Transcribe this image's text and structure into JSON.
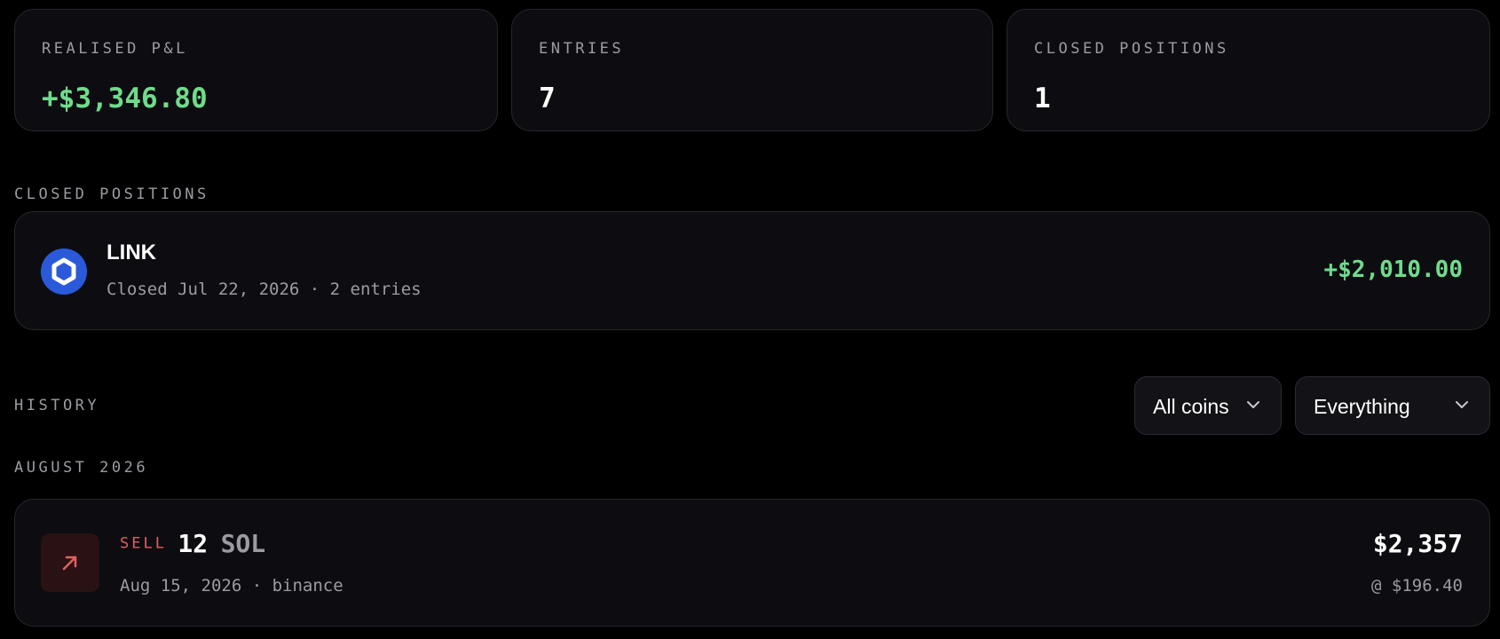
{
  "stats": [
    {
      "label": "REALISED P&L",
      "value": "+$3,346.80"
    },
    {
      "label": "ENTRIES",
      "value": "7"
    },
    {
      "label": "CLOSED POSITIONS",
      "value": "1"
    }
  ],
  "closed_positions": {
    "heading": "CLOSED POSITIONS",
    "items": [
      {
        "coin": "LINK",
        "icon": "chainlink-icon",
        "meta": "Closed Jul 22, 2026 · 2 entries",
        "pnl": "+$2,010.00"
      }
    ]
  },
  "history": {
    "heading": "HISTORY",
    "filters": {
      "coin": "All coins",
      "type": "Everything"
    },
    "groups": [
      {
        "month": "AUGUST 2026",
        "entries": [
          {
            "side": "SELL",
            "quantity": "12",
            "coin": "SOL",
            "meta": "Aug 15, 2026 · binance",
            "total": "$2,357",
            "price": "@ $196.40",
            "icon": "arrow-up-right-icon"
          }
        ]
      }
    ]
  },
  "colors": {
    "positive": "#6fdc8c",
    "sell": "#e06060",
    "link_blue": "#2a5ada",
    "background": "#000000",
    "card": "#0d0d11"
  }
}
